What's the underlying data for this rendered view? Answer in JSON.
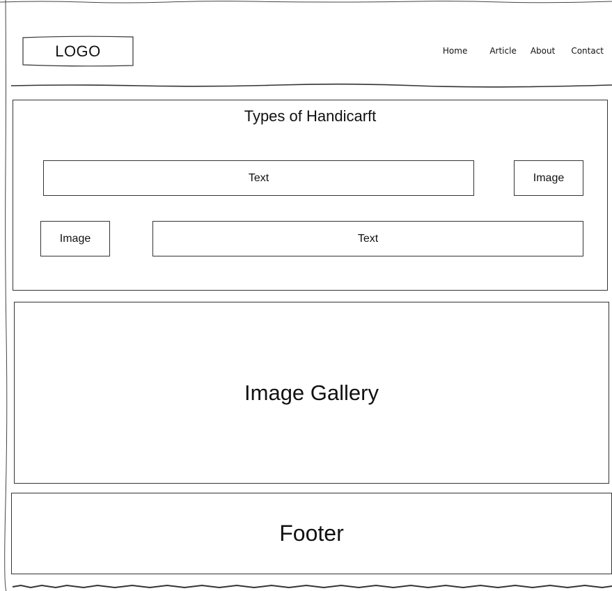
{
  "header": {
    "logo": "LOGO",
    "nav": [
      "Home",
      "Article",
      "About",
      "Contact"
    ]
  },
  "types_section": {
    "title": "Types of Handicarft",
    "row1": {
      "text": "Text",
      "image": "Image"
    },
    "row2": {
      "image": "Image",
      "text": "Text"
    }
  },
  "gallery": {
    "label": "Image Gallery"
  },
  "footer": {
    "label": "Footer"
  }
}
